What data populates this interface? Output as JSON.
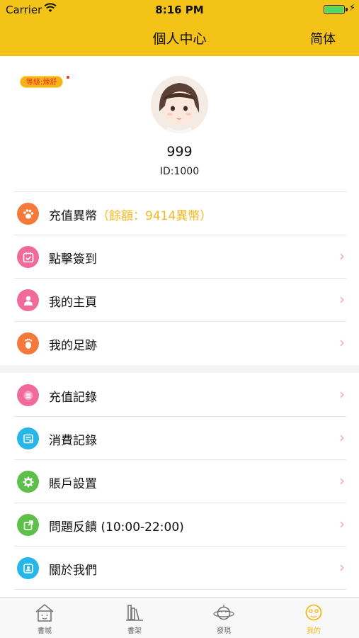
{
  "status_bar": {
    "carrier": "Carrier",
    "time": "8:16 PM"
  },
  "nav": {
    "title": "個人中心",
    "language_toggle": "简体"
  },
  "profile": {
    "level_badge": "等級:煉舒",
    "username": "999",
    "user_id": "ID:1000"
  },
  "menu_group_1": [
    {
      "label": "充值異幣",
      "sub": "（餘額：9414異幣）",
      "icon": "paw-icon",
      "color": "#f47a3c"
    },
    {
      "label": "點擊簽到",
      "icon": "calendar-check-icon",
      "color": "#f06a9a"
    },
    {
      "label": "我的主頁",
      "icon": "user-icon",
      "color": "#f06a9a"
    },
    {
      "label": "我的足跡",
      "icon": "footprint-icon",
      "color": "#f47a3c"
    }
  ],
  "menu_group_2": [
    {
      "label": "充值記錄",
      "icon": "list-icon",
      "color": "#f06a9a"
    },
    {
      "label": "消費記錄",
      "icon": "receipt-icon",
      "color": "#26b6e8"
    },
    {
      "label": "賬戶設置",
      "icon": "gear-icon",
      "color": "#5ec04a"
    },
    {
      "label": "問題反饋 (10:00-22:00)",
      "icon": "feedback-icon",
      "color": "#5ec04a"
    },
    {
      "label": "關於我們",
      "icon": "contact-icon",
      "color": "#26b6e8"
    }
  ],
  "tabbar": [
    {
      "label": "書城",
      "icon": "house-icon",
      "active": false
    },
    {
      "label": "書架",
      "icon": "bookshelf-icon",
      "active": false
    },
    {
      "label": "發現",
      "icon": "planet-icon",
      "active": false
    },
    {
      "label": "我的",
      "icon": "face-icon",
      "active": true
    }
  ],
  "colors": {
    "header": "#f4c318",
    "accent": "#f4b91e",
    "chevron": "#f2a6b6"
  }
}
